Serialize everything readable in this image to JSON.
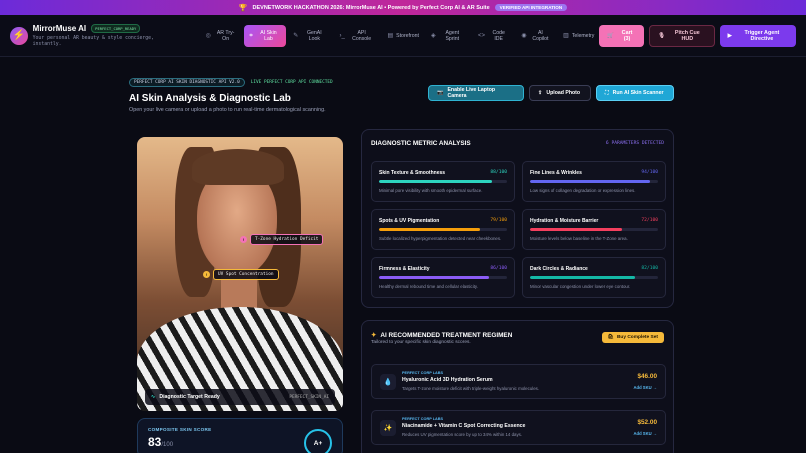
{
  "banner": {
    "icon": "trophy-icon",
    "text": "DEVNETWORK HACKATHON 2026: MirrorMuse AI • Powered by Perfect Corp AI & AR Suite",
    "pill": "VERIFIED API INTEGRATION"
  },
  "brand": {
    "name": "MirrorMuse AI",
    "badge": "PERFECT_CORP_READY",
    "tagline": "Your personal AR beauty & style concierge, instantly."
  },
  "tabs": [
    {
      "icon": "sparkles-icon",
      "label": "AR Try-On"
    },
    {
      "icon": "scan-icon",
      "label": "AI Skin Lab"
    },
    {
      "icon": "wand-icon",
      "label": "GenAI Look"
    },
    {
      "icon": "terminal-icon",
      "label": "API Console"
    },
    {
      "icon": "store-icon",
      "label": "Storefront"
    },
    {
      "icon": "robot-icon",
      "label": "Agent Sprint"
    },
    {
      "icon": "code-icon",
      "label": "Code IDE"
    },
    {
      "icon": "bot-icon",
      "label": "AI Copilot"
    },
    {
      "icon": "chart-icon",
      "label": "Telemetry"
    }
  ],
  "active_tab": 1,
  "nav_actions": {
    "cart": "Cart (3)",
    "pitch": "Pitch Cue HUD",
    "trigger": "Trigger Agent Directive"
  },
  "header": {
    "badge": "PERFECT CORP AI SKIN DIAGNOSTIC API V2.0",
    "status": "LIVE PERFECT CORP API CONNECTED",
    "title": "AI Skin Analysis & Diagnostic Lab",
    "subtitle": "Open your live camera or upload a photo to run real-time dermatological scanning."
  },
  "actions": {
    "camera": "Enable Live Laptop Camera",
    "upload": "Upload Photo",
    "run": "Run AI Skin Scanner"
  },
  "photo": {
    "tag1": "T-Zone Hydration Deficit",
    "tag2": "UV Spot Concentration",
    "status": "Diagnostic Target Ready",
    "file": "PERFECT_SKIN_AI"
  },
  "score": {
    "label": "COMPOSITE SKIN SCORE",
    "value": "83",
    "max": "/100",
    "grade": "A+"
  },
  "metrics": {
    "title": "DIAGNOSTIC METRIC ANALYSIS",
    "count": "6 PARAMETERS DETECTED",
    "items": [
      {
        "name": "Skin Texture & Smoothness",
        "score": "88/100",
        "value": 88,
        "color": "#2dd4bf",
        "desc": "Minimal pore visibility with smooth epidermal surface."
      },
      {
        "name": "Fine Lines & Wrinkles",
        "score": "94/100",
        "value": 94,
        "color": "#6366f1",
        "desc": "Low signs of collagen degradation or expression lines."
      },
      {
        "name": "Spots & UV Pigmentation",
        "score": "79/100",
        "value": 79,
        "color": "#f59e0b",
        "desc": "Subtle localized hyperpigmentation detected near cheekbones."
      },
      {
        "name": "Hydration & Moisture Barrier",
        "score": "72/100",
        "value": 72,
        "color": "#f43f5e",
        "desc": "Moisture levels below baseline in the T-Zone area."
      },
      {
        "name": "Firmness & Elasticity",
        "score": "86/100",
        "value": 86,
        "color": "#8b5cf6",
        "desc": "Healthy dermal rebound time and cellular elasticity."
      },
      {
        "name": "Dark Circles & Radiance",
        "score": "82/100",
        "value": 82,
        "color": "#14b8a6",
        "desc": "Minor vascular congestion under lower eye contour."
      }
    ]
  },
  "regimen": {
    "title": "AI RECOMMENDED TREATMENT REGIMEN",
    "subtitle": "Tailored to your specific skin diagnostic scores.",
    "buy": "Buy Complete Set",
    "products": [
      {
        "icon": "droplet-icon",
        "glyph": "💧",
        "brand": "PERFECT CORP LABS",
        "name": "Hyaluronic Acid 3D Hydration Serum",
        "desc": "Targets T-zone moisture deficit with triple-weight hyaluronic molecules.",
        "price": "$46.00",
        "add": "Add SKU →"
      },
      {
        "icon": "sparkle-icon",
        "glyph": "✨",
        "brand": "PERFECT CORP LABS",
        "name": "Niacinamide + Vitamin C Spot Correcting Essence",
        "desc": "Reduces UV pigmentation score by up to 34% within 14 days.",
        "price": "$52.00",
        "add": "Add SKU →"
      }
    ]
  }
}
